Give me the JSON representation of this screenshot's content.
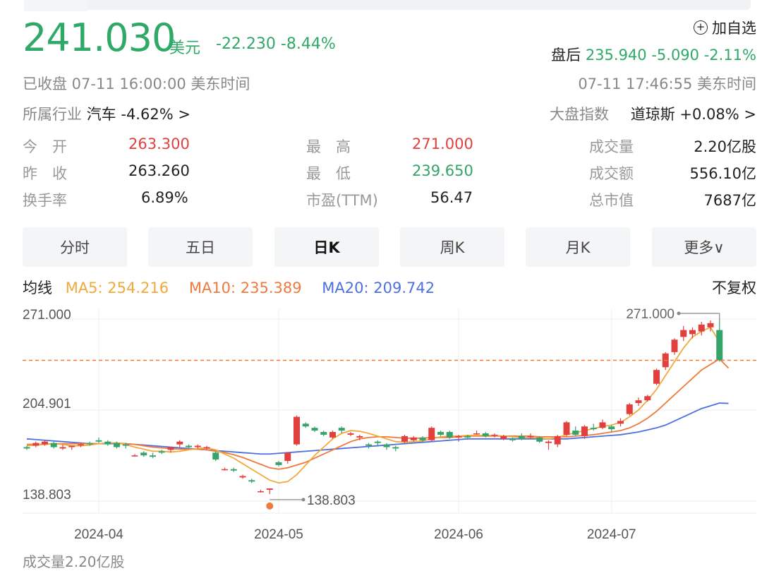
{
  "quote": {
    "price": "241.030",
    "currency": "美元",
    "change": "-22.230 -8.44%",
    "add_watch": "加自选",
    "after_label": "盘后",
    "after_value": "235.940 -5.090 -2.11%",
    "status": "已收盘  07-11 16:00:00  美东时间",
    "after_time": "07-11 17:46:55  美东时间",
    "industry_label": "所属行业",
    "industry_value": "汽车 -4.62% >",
    "index_label": "大盘指数",
    "index_value": "道琼斯 +0.08% >"
  },
  "stats": {
    "open_label": "今　开",
    "open": "263.300",
    "prev_label": "昨　收",
    "prev": "263.260",
    "turnover_label": "换手率",
    "turnover": "6.89%",
    "high_label": "最　高",
    "high": "271.000",
    "low_label": "最　低",
    "low": "239.650",
    "pe_label": "市盈(TTM)",
    "pe": "56.47",
    "vol_label": "成交量",
    "vol": "2.20亿股",
    "amt_label": "成交额",
    "amt": "556.10亿",
    "cap_label": "总市值",
    "cap": "7687亿"
  },
  "tabs": [
    "分时",
    "五日",
    "日K",
    "周K",
    "月K",
    "更多∨"
  ],
  "ma": {
    "label": "均线",
    "ma5": "MA5: 254.216",
    "ma10": "MA10: 235.389",
    "ma20": "MA20: 209.742",
    "fq": "不复权"
  },
  "colors": {
    "up": "#e2403f",
    "down": "#35a36a",
    "ma5": "#f2a93b",
    "ma10": "#ee7a3c",
    "ma20": "#4e6fe0",
    "green_text": "#2fa968"
  },
  "volume_label": "成交量2.20亿股",
  "chart_data": {
    "type": "candlestick",
    "y_ticks": [
      "271.000",
      "204.901",
      "138.803"
    ],
    "ylim": [
      138.803,
      271.0
    ],
    "x_ticks": [
      {
        "label": "2024-04",
        "index": 8
      },
      {
        "label": "2024-05",
        "index": 28
      },
      {
        "label": "2024-06",
        "index": 48
      },
      {
        "label": "2024-07",
        "index": 65
      }
    ],
    "max_label": "271.000",
    "min_label": "138.803",
    "last_close": 241.03,
    "candles": [
      [
        178,
        179,
        176,
        177
      ],
      [
        179,
        182,
        178,
        181
      ],
      [
        180,
        183,
        179,
        182
      ],
      [
        181,
        182,
        177,
        178
      ],
      [
        177,
        180,
        176,
        178
      ],
      [
        178,
        179,
        176,
        179
      ],
      [
        180,
        181,
        178,
        180
      ],
      [
        181,
        182,
        179,
        180
      ],
      [
        183,
        185,
        181,
        182
      ],
      [
        182,
        183,
        179,
        180
      ],
      [
        181,
        182,
        177,
        178
      ],
      [
        180,
        181,
        177,
        179
      ],
      [
        172,
        173,
        171,
        172
      ],
      [
        174,
        175,
        171,
        172
      ],
      [
        172,
        174,
        170,
        171
      ],
      [
        175,
        176,
        173,
        174
      ],
      [
        176,
        177,
        174,
        178
      ],
      [
        180,
        183,
        178,
        182
      ],
      [
        179,
        180,
        177,
        178
      ],
      [
        178,
        180,
        177,
        179
      ],
      [
        177,
        179,
        176,
        178
      ],
      [
        174,
        175,
        168,
        169
      ],
      [
        162,
        163,
        161,
        162
      ],
      [
        162,
        163,
        160,
        161
      ],
      [
        156,
        158,
        155,
        157
      ],
      [
        154,
        155,
        152,
        153
      ],
      [
        146,
        147,
        145,
        146
      ],
      [
        147,
        148,
        144,
        148
      ],
      [
        167,
        168,
        164,
        165
      ],
      [
        168,
        174,
        166,
        174
      ],
      [
        180,
        201,
        179,
        200
      ],
      [
        195,
        196,
        192,
        193
      ],
      [
        192,
        193,
        189,
        190
      ],
      [
        189,
        190,
        186,
        187
      ],
      [
        185,
        190,
        184,
        189
      ],
      [
        192,
        193,
        188,
        190
      ],
      [
        187,
        189,
        186,
        188
      ],
      [
        185,
        187,
        183,
        186
      ],
      [
        180,
        181,
        177,
        179
      ],
      [
        182,
        183,
        179,
        181
      ],
      [
        180,
        181,
        176,
        178
      ],
      [
        178,
        179,
        175,
        177
      ],
      [
        182,
        187,
        181,
        186
      ],
      [
        183,
        186,
        182,
        185
      ],
      [
        185,
        186,
        181,
        183
      ],
      [
        183,
        193,
        182,
        192
      ],
      [
        189,
        190,
        186,
        187
      ],
      [
        189,
        190,
        184,
        185
      ],
      [
        185,
        187,
        182,
        186
      ],
      [
        186,
        187,
        184,
        185
      ],
      [
        188,
        190,
        187,
        188
      ],
      [
        188,
        189,
        185,
        186
      ],
      [
        187,
        188,
        185,
        187
      ],
      [
        184,
        187,
        183,
        186
      ],
      [
        184,
        185,
        182,
        183
      ],
      [
        186,
        188,
        183,
        184
      ],
      [
        186,
        188,
        184,
        186
      ],
      [
        185,
        186,
        181,
        182
      ],
      [
        181,
        183,
        176,
        182
      ],
      [
        180,
        187,
        178,
        186
      ],
      [
        187,
        197,
        186,
        196
      ],
      [
        190,
        193,
        186,
        187
      ],
      [
        186,
        194,
        184,
        193
      ],
      [
        192,
        195,
        190,
        191
      ],
      [
        192,
        198,
        191,
        196
      ],
      [
        193,
        194,
        189,
        191
      ],
      [
        195,
        199,
        193,
        197
      ],
      [
        202,
        210,
        201,
        209
      ],
      [
        210,
        214,
        208,
        212
      ],
      [
        212,
        216,
        211,
        215
      ],
      [
        224,
        235,
        223,
        234
      ],
      [
        236,
        247,
        234,
        246
      ],
      [
        247,
        257,
        245,
        256
      ],
      [
        258,
        266,
        255,
        263
      ],
      [
        260,
        265,
        257,
        263
      ],
      [
        262,
        269,
        259,
        267
      ],
      [
        265,
        270,
        262,
        268
      ],
      [
        263,
        271,
        240,
        241
      ]
    ],
    "ma5": [
      179,
      179.5,
      180,
      180.5,
      180,
      179,
      179,
      179.5,
      180.5,
      181,
      181,
      180,
      178,
      176.5,
      175,
      175,
      174.5,
      175,
      176,
      177,
      177.5,
      176,
      173,
      170,
      166,
      162,
      158,
      154,
      152,
      153,
      158,
      165,
      172,
      178,
      184,
      188,
      190,
      189.5,
      188,
      186,
      184,
      182,
      181.5,
      182,
      182.5,
      184,
      185.5,
      186,
      186,
      186.5,
      186.5,
      186.5,
      186.5,
      186,
      185.5,
      185,
      185,
      184.5,
      184,
      185,
      187,
      188.5,
      190,
      191.5,
      193,
      194,
      196,
      200,
      205,
      212,
      220,
      230,
      240,
      250,
      258,
      262,
      265,
      254.216
    ],
    "ma10": [
      180,
      180,
      180,
      180.5,
      180.5,
      180.5,
      180.5,
      180.5,
      180.5,
      181,
      181,
      180.5,
      180,
      179,
      178,
      177.5,
      177,
      176.5,
      176.5,
      176.5,
      176,
      175,
      174,
      172.5,
      170.5,
      168,
      165.5,
      163,
      162,
      163,
      165,
      167,
      170,
      173,
      176,
      179,
      182,
      184,
      185,
      185.5,
      185.5,
      185,
      184.5,
      184.5,
      184.5,
      185,
      185,
      185,
      185.5,
      186,
      186,
      186,
      186,
      186,
      186,
      186,
      186,
      185.5,
      185.5,
      185.5,
      185.5,
      186,
      186.5,
      187,
      188,
      189,
      190,
      192,
      195,
      199,
      204,
      210,
      216,
      222,
      228,
      234,
      238,
      242,
      235.389
    ],
    "ma20": [
      184,
      183.5,
      183,
      182.5,
      182,
      181.5,
      181,
      180.5,
      180.5,
      180.5,
      180.5,
      180.5,
      180,
      179.5,
      179,
      178.5,
      178,
      177.5,
      177,
      176.5,
      176,
      175.5,
      175,
      174.5,
      174,
      173.5,
      173,
      173,
      173.5,
      174,
      174.5,
      175,
      175.5,
      176,
      176.5,
      177,
      177.5,
      178,
      178.5,
      179,
      179.5,
      180,
      180.5,
      181,
      181.5,
      182,
      182.5,
      183,
      183.5,
      184,
      184,
      184,
      184,
      184,
      184,
      184,
      184,
      184,
      184,
      184,
      184,
      184.5,
      185,
      185.5,
      186,
      186.5,
      187,
      188,
      189,
      190.5,
      192,
      194,
      197,
      200,
      203,
      206,
      208,
      210,
      209.742
    ]
  }
}
